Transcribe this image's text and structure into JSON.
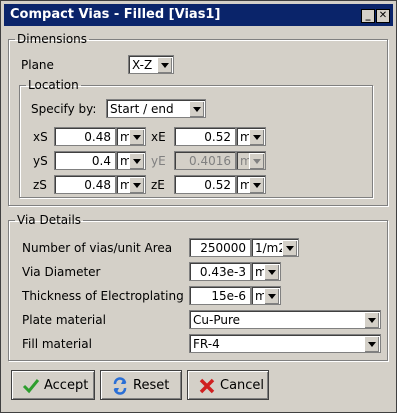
{
  "window": {
    "title": "Compact Vias - Filled [Vias1]"
  },
  "dimensions": {
    "legend": "Dimensions",
    "plane_label": "Plane",
    "plane_value": "X-Z",
    "location": {
      "legend": "Location",
      "specify_label": "Specify by:",
      "specify_value": "Start / end",
      "xs": {
        "label": "xS",
        "value": "0.48",
        "unit": "m"
      },
      "ys": {
        "label": "yS",
        "value": "0.4",
        "unit": "m"
      },
      "zs": {
        "label": "zS",
        "value": "0.48",
        "unit": "m"
      },
      "xe": {
        "label": "xE",
        "value": "0.52",
        "unit": "m"
      },
      "ye": {
        "label": "yE",
        "value": "0.4016",
        "unit": "m"
      },
      "ze": {
        "label": "zE",
        "value": "0.52",
        "unit": "m"
      }
    }
  },
  "via_details": {
    "legend": "Via Details",
    "num_vias_label": "Number of vias/unit Area",
    "num_vias_value": "250000",
    "num_vias_unit": "1/m2",
    "diameter_label": "Via Diameter",
    "diameter_value": "0.43e-3",
    "diameter_unit": "m",
    "thickness_label": "Thickness of Electroplating",
    "thickness_value": "15e-6",
    "thickness_unit": "m",
    "plate_label": "Plate material",
    "plate_value": "Cu-Pure",
    "fill_label": "Fill material",
    "fill_value": "FR-4"
  },
  "buttons": {
    "accept": "Accept",
    "reset": "Reset",
    "cancel": "Cancel"
  },
  "colors": {
    "title_bg": "#0a246a",
    "accept_icon": "#2e9e2e",
    "reset_icon": "#2a6fd6",
    "cancel_icon": "#d02020"
  }
}
